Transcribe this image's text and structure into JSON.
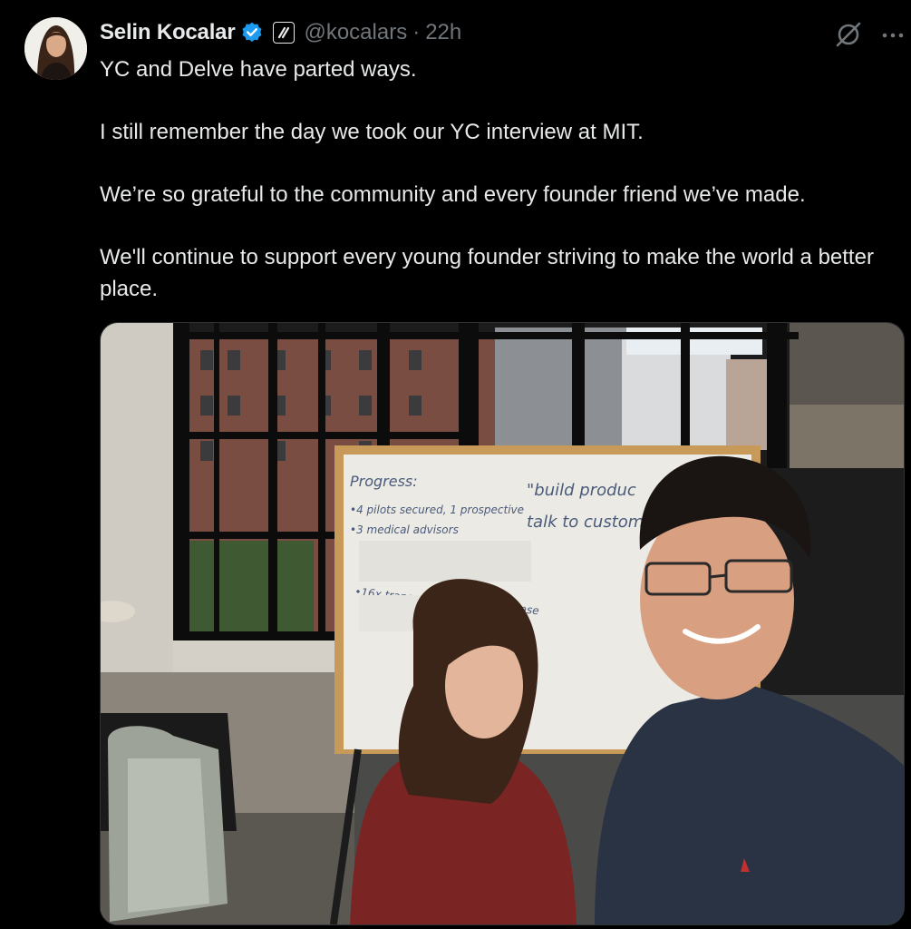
{
  "author": {
    "name": "Selin Kocalar",
    "handle": "@kocalars",
    "separator": "·",
    "time": "22h",
    "verified_icon": "verified-badge-icon",
    "affiliation_icon": "affiliate-badge-icon",
    "accent": "#1d9bf0"
  },
  "tweet": {
    "paragraphs": [
      "YC and Delve have parted ways.",
      "I still remember the day we took our YC interview at MIT.",
      "We’re so grateful to the community and every founder friend we’ve made.",
      "We'll continue to support every young founder striving to make the world a better place."
    ]
  },
  "actions": {
    "grok_icon": "grok-icon",
    "more_icon": "more-icon"
  },
  "media": {
    "whiteboard": {
      "heading": "Progress:",
      "line1": "•4 pilots secured, 1 prospective",
      "line2": "•3 medical advisors",
      "line3": "•16x transcription speed increase",
      "quote1": "\"build produc",
      "quote2": "talk to customers"
    }
  },
  "colors": {
    "background": "#000000",
    "text": "#e7e9ea",
    "muted": "#71767b"
  }
}
